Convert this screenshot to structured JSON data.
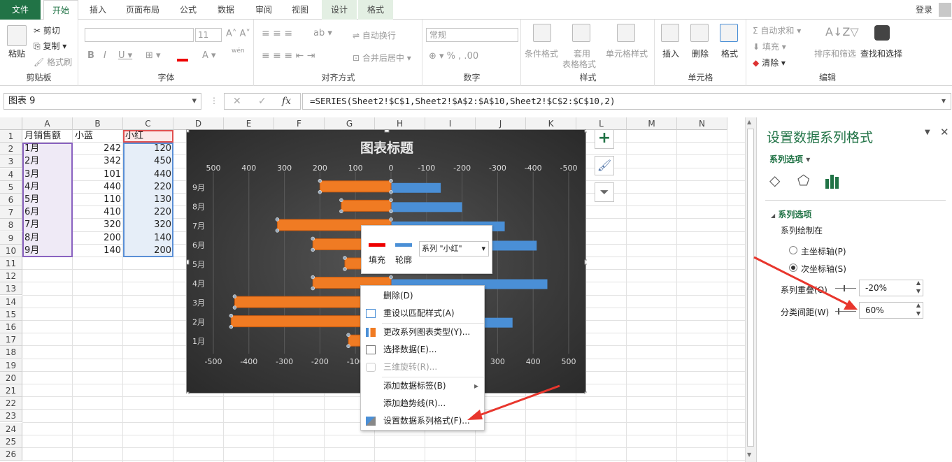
{
  "ribbon": {
    "tabs": [
      "文件",
      "开始",
      "插入",
      "页面布局",
      "公式",
      "数据",
      "审阅",
      "视图",
      "设计",
      "格式"
    ],
    "login": "登录",
    "clipboard": {
      "paste": "粘贴",
      "cut": "剪切",
      "copy": "复制",
      "format_painter": "格式刷",
      "label": "剪贴板"
    },
    "font": {
      "size": "11",
      "label": "字体",
      "wen": "wén"
    },
    "align": {
      "wrap": "自动换行",
      "merge": "合并后居中",
      "label": "对齐方式"
    },
    "number": {
      "format": "常规",
      "label": "数字"
    },
    "styles": {
      "cond": "条件格式",
      "table": "套用",
      "table2": "表格格式",
      "cell": "单元格样式",
      "label": "样式"
    },
    "cells": {
      "insert": "插入",
      "delete": "删除",
      "format": "格式",
      "label": "单元格"
    },
    "edit": {
      "autosum": "自动求和",
      "fill": "填充",
      "clear": "清除",
      "sort": "排序和筛选",
      "find": "查找和选择",
      "label": "编辑"
    }
  },
  "formula": {
    "name": "图表 9",
    "fx": "fx",
    "content": "=SERIES(Sheet2!$C$1,Sheet2!$A$2:$A$10,Sheet2!$C$2:$C$10,2)"
  },
  "grid": {
    "cols": [
      "A",
      "B",
      "C",
      "D",
      "E",
      "F",
      "G",
      "H",
      "I",
      "J",
      "K",
      "L",
      "M",
      "N"
    ],
    "rows": [
      "1",
      "2",
      "3",
      "4",
      "5",
      "6",
      "7",
      "8",
      "9",
      "10",
      "11",
      "12",
      "13",
      "14",
      "15",
      "16",
      "17",
      "18",
      "19",
      "20",
      "21",
      "22",
      "23",
      "24",
      "25",
      "26"
    ],
    "header": [
      "月销售额",
      "小蓝",
      "小红"
    ],
    "data": [
      [
        "1月",
        "242",
        "120"
      ],
      [
        "2月",
        "342",
        "450"
      ],
      [
        "3月",
        "101",
        "440"
      ],
      [
        "4月",
        "440",
        "220"
      ],
      [
        "5月",
        "110",
        "130"
      ],
      [
        "6月",
        "410",
        "220"
      ],
      [
        "7月",
        "320",
        "320"
      ],
      [
        "8月",
        "200",
        "140"
      ],
      [
        "9月",
        "140",
        "200"
      ]
    ]
  },
  "chart_data": {
    "type": "bar",
    "title": "图表标题",
    "categories": [
      "1月",
      "2月",
      "3月",
      "4月",
      "5月",
      "6月",
      "7月",
      "8月",
      "9月"
    ],
    "series": [
      {
        "name": "小蓝",
        "color": "#4a8fd6",
        "values": [
          242,
          342,
          101,
          440,
          110,
          410,
          320,
          200,
          140
        ]
      },
      {
        "name": "小红",
        "color": "#f07b23",
        "values": [
          120,
          450,
          440,
          220,
          130,
          220,
          320,
          140,
          200
        ]
      }
    ],
    "top_axis_ticks": [
      "500",
      "400",
      "300",
      "200",
      "100",
      "0",
      "-100",
      "-200",
      "-300",
      "-400",
      "-500"
    ],
    "bottom_axis_ticks": [
      "-500",
      "-400",
      "-300",
      "-200",
      "-100",
      "0",
      "100",
      "200",
      "300",
      "400",
      "500"
    ],
    "xlim": [
      -500,
      500
    ]
  },
  "mini_toolbar": {
    "fill": "填充",
    "outline": "轮廓",
    "series_select": "系列 \"小红\""
  },
  "context_menu": [
    {
      "label": "删除(D)",
      "enabled": true
    },
    {
      "label": "重设以匹配样式(A)",
      "enabled": true
    },
    {
      "label": "更改系列图表类型(Y)...",
      "enabled": true
    },
    {
      "label": "选择数据(E)...",
      "enabled": true
    },
    {
      "label": "三维旋转(R)...",
      "enabled": false
    },
    {
      "label": "添加数据标签(B)",
      "enabled": true
    },
    {
      "label": "添加趋势线(R)...",
      "enabled": true
    },
    {
      "label": "设置数据系列格式(F)...",
      "enabled": true
    }
  ],
  "pane": {
    "title": "设置数据系列格式",
    "dropdown": "系列选项",
    "section": "系列选项",
    "plot_on": "系列绘制在",
    "primary": "主坐标轴(P)",
    "secondary": "次坐标轴(S)",
    "overlap_label": "系列重叠(O)",
    "overlap_value": "-20%",
    "gap_label": "分类间距(W)",
    "gap_value": "60%"
  },
  "colors": {
    "excel_green": "#217346",
    "arrow": "#e8362d",
    "blue": "#4a8fd6",
    "orange": "#f07b23"
  }
}
